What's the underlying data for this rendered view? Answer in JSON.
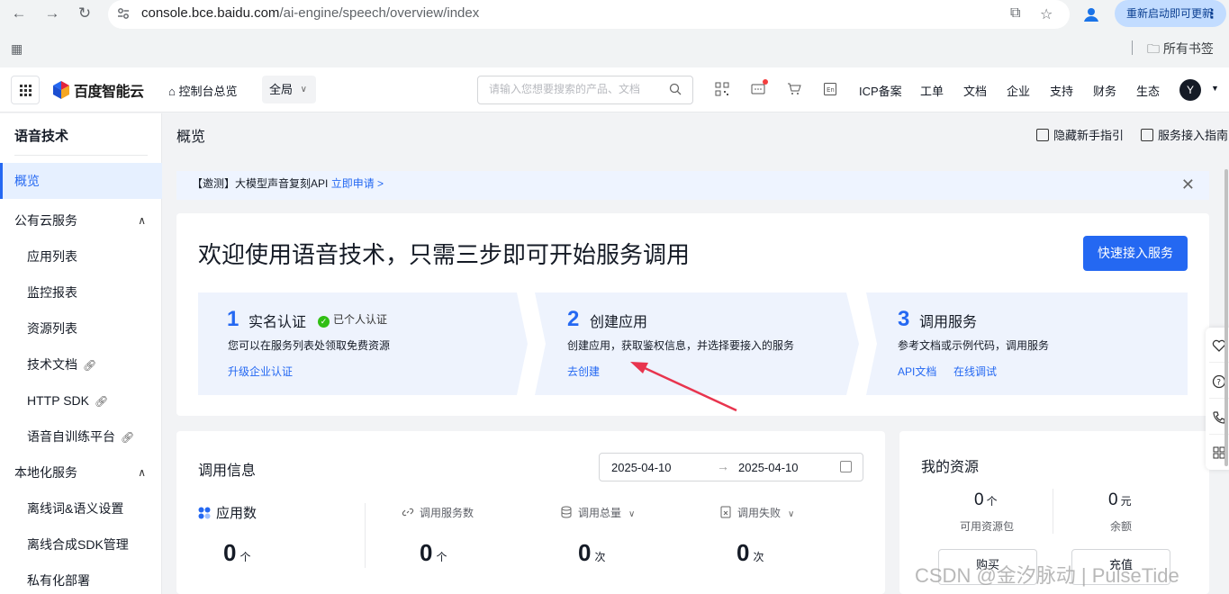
{
  "browser": {
    "url_host": "console.bce.baidu.com",
    "url_path": "/ai-engine/speech/overview/index",
    "update_button": "重新启动即可更新",
    "bookmarks_label": "所有书签"
  },
  "header": {
    "logo_text": "百度智能云",
    "console_home": "控制台总览",
    "scope": "全局",
    "search_placeholder": "请输入您想要搜索的产品、文档",
    "links": [
      "ICP备案",
      "工单",
      "文档",
      "企业",
      "支持",
      "财务",
      "生态"
    ],
    "avatar_letter": "Y"
  },
  "sidebar": {
    "title": "语音技术",
    "items": [
      {
        "label": "概览"
      },
      {
        "label": "公有云服务"
      },
      {
        "label": "应用列表"
      },
      {
        "label": "监控报表"
      },
      {
        "label": "资源列表"
      },
      {
        "label": "技术文档"
      },
      {
        "label": "HTTP SDK"
      },
      {
        "label": "语音自训练平台"
      },
      {
        "label": "本地化服务"
      },
      {
        "label": "离线词&语义设置"
      },
      {
        "label": "离线合成SDK管理"
      },
      {
        "label": "私有化部署"
      }
    ]
  },
  "page": {
    "title": "概览",
    "hide_guide": "隐藏新手指引",
    "access_guide": "服务接入指南"
  },
  "notice": {
    "text": "【邀测】大模型声音复刻API ",
    "link": "立即申请 >"
  },
  "welcome": {
    "title": "欢迎使用语音技术，只需三步即可开始服务调用",
    "quick_access_button": "快速接入服务",
    "steps": [
      {
        "num": "1",
        "title": "实名认证",
        "badge": "已个人认证",
        "desc": "您可以在服务列表处领取免费资源",
        "links": [
          "升级企业认证"
        ]
      },
      {
        "num": "2",
        "title": "创建应用",
        "desc": "创建应用，获取鉴权信息，并选择要接入的服务",
        "links": [
          "去创建"
        ]
      },
      {
        "num": "3",
        "title": "调用服务",
        "desc": "参考文档或示例代码，调用服务",
        "links": [
          "API文档",
          "在线调试"
        ]
      }
    ]
  },
  "call_info": {
    "title": "调用信息",
    "date_start": "2025-04-10",
    "date_end": "2025-04-10",
    "metrics": [
      {
        "label": "应用数",
        "value": "0",
        "unit": "个"
      },
      {
        "label": "调用服务数",
        "value": "0",
        "unit": "个"
      },
      {
        "label": "调用总量",
        "value": "0",
        "unit": "次"
      },
      {
        "label": "调用失败",
        "value": "0",
        "unit": "次"
      }
    ]
  },
  "resources": {
    "title": "我的资源",
    "packages_value": "0",
    "packages_unit": "个",
    "packages_label": "可用资源包",
    "balance_value": "0",
    "balance_unit": "元",
    "balance_label": "余额",
    "buy_button": "购买",
    "recharge_button": "充值"
  },
  "watermark": "CSDN @金汐脉动 | PulseTide",
  "colors": {
    "primary": "#2468f2",
    "notice_bg": "#eef4ff",
    "step_bg": "#eef3fd",
    "verified": "#30bf13",
    "annotation_arrow": "#e8344e"
  }
}
